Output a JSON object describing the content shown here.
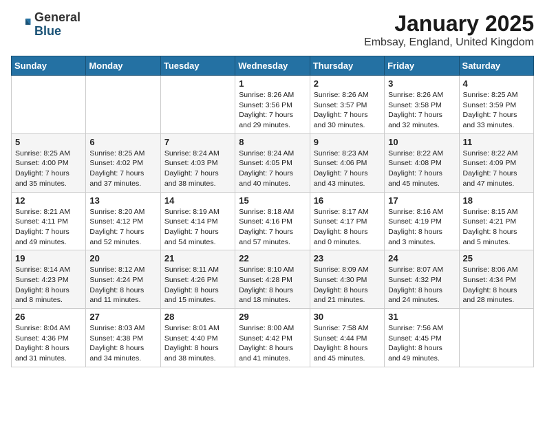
{
  "logo": {
    "general": "General",
    "blue": "Blue"
  },
  "title": {
    "month": "January 2025",
    "location": "Embsay, England, United Kingdom"
  },
  "days_of_week": [
    "Sunday",
    "Monday",
    "Tuesday",
    "Wednesday",
    "Thursday",
    "Friday",
    "Saturday"
  ],
  "weeks": [
    [
      {
        "day": "",
        "detail": ""
      },
      {
        "day": "",
        "detail": ""
      },
      {
        "day": "",
        "detail": ""
      },
      {
        "day": "1",
        "detail": "Sunrise: 8:26 AM\nSunset: 3:56 PM\nDaylight: 7 hours and 29 minutes."
      },
      {
        "day": "2",
        "detail": "Sunrise: 8:26 AM\nSunset: 3:57 PM\nDaylight: 7 hours and 30 minutes."
      },
      {
        "day": "3",
        "detail": "Sunrise: 8:26 AM\nSunset: 3:58 PM\nDaylight: 7 hours and 32 minutes."
      },
      {
        "day": "4",
        "detail": "Sunrise: 8:25 AM\nSunset: 3:59 PM\nDaylight: 7 hours and 33 minutes."
      }
    ],
    [
      {
        "day": "5",
        "detail": "Sunrise: 8:25 AM\nSunset: 4:00 PM\nDaylight: 7 hours and 35 minutes."
      },
      {
        "day": "6",
        "detail": "Sunrise: 8:25 AM\nSunset: 4:02 PM\nDaylight: 7 hours and 37 minutes."
      },
      {
        "day": "7",
        "detail": "Sunrise: 8:24 AM\nSunset: 4:03 PM\nDaylight: 7 hours and 38 minutes."
      },
      {
        "day": "8",
        "detail": "Sunrise: 8:24 AM\nSunset: 4:05 PM\nDaylight: 7 hours and 40 minutes."
      },
      {
        "day": "9",
        "detail": "Sunrise: 8:23 AM\nSunset: 4:06 PM\nDaylight: 7 hours and 43 minutes."
      },
      {
        "day": "10",
        "detail": "Sunrise: 8:22 AM\nSunset: 4:08 PM\nDaylight: 7 hours and 45 minutes."
      },
      {
        "day": "11",
        "detail": "Sunrise: 8:22 AM\nSunset: 4:09 PM\nDaylight: 7 hours and 47 minutes."
      }
    ],
    [
      {
        "day": "12",
        "detail": "Sunrise: 8:21 AM\nSunset: 4:11 PM\nDaylight: 7 hours and 49 minutes."
      },
      {
        "day": "13",
        "detail": "Sunrise: 8:20 AM\nSunset: 4:12 PM\nDaylight: 7 hours and 52 minutes."
      },
      {
        "day": "14",
        "detail": "Sunrise: 8:19 AM\nSunset: 4:14 PM\nDaylight: 7 hours and 54 minutes."
      },
      {
        "day": "15",
        "detail": "Sunrise: 8:18 AM\nSunset: 4:16 PM\nDaylight: 7 hours and 57 minutes."
      },
      {
        "day": "16",
        "detail": "Sunrise: 8:17 AM\nSunset: 4:17 PM\nDaylight: 8 hours and 0 minutes."
      },
      {
        "day": "17",
        "detail": "Sunrise: 8:16 AM\nSunset: 4:19 PM\nDaylight: 8 hours and 3 minutes."
      },
      {
        "day": "18",
        "detail": "Sunrise: 8:15 AM\nSunset: 4:21 PM\nDaylight: 8 hours and 5 minutes."
      }
    ],
    [
      {
        "day": "19",
        "detail": "Sunrise: 8:14 AM\nSunset: 4:23 PM\nDaylight: 8 hours and 8 minutes."
      },
      {
        "day": "20",
        "detail": "Sunrise: 8:12 AM\nSunset: 4:24 PM\nDaylight: 8 hours and 11 minutes."
      },
      {
        "day": "21",
        "detail": "Sunrise: 8:11 AM\nSunset: 4:26 PM\nDaylight: 8 hours and 15 minutes."
      },
      {
        "day": "22",
        "detail": "Sunrise: 8:10 AM\nSunset: 4:28 PM\nDaylight: 8 hours and 18 minutes."
      },
      {
        "day": "23",
        "detail": "Sunrise: 8:09 AM\nSunset: 4:30 PM\nDaylight: 8 hours and 21 minutes."
      },
      {
        "day": "24",
        "detail": "Sunrise: 8:07 AM\nSunset: 4:32 PM\nDaylight: 8 hours and 24 minutes."
      },
      {
        "day": "25",
        "detail": "Sunrise: 8:06 AM\nSunset: 4:34 PM\nDaylight: 8 hours and 28 minutes."
      }
    ],
    [
      {
        "day": "26",
        "detail": "Sunrise: 8:04 AM\nSunset: 4:36 PM\nDaylight: 8 hours and 31 minutes."
      },
      {
        "day": "27",
        "detail": "Sunrise: 8:03 AM\nSunset: 4:38 PM\nDaylight: 8 hours and 34 minutes."
      },
      {
        "day": "28",
        "detail": "Sunrise: 8:01 AM\nSunset: 4:40 PM\nDaylight: 8 hours and 38 minutes."
      },
      {
        "day": "29",
        "detail": "Sunrise: 8:00 AM\nSunset: 4:42 PM\nDaylight: 8 hours and 41 minutes."
      },
      {
        "day": "30",
        "detail": "Sunrise: 7:58 AM\nSunset: 4:44 PM\nDaylight: 8 hours and 45 minutes."
      },
      {
        "day": "31",
        "detail": "Sunrise: 7:56 AM\nSunset: 4:45 PM\nDaylight: 8 hours and 49 minutes."
      },
      {
        "day": "",
        "detail": ""
      }
    ]
  ]
}
